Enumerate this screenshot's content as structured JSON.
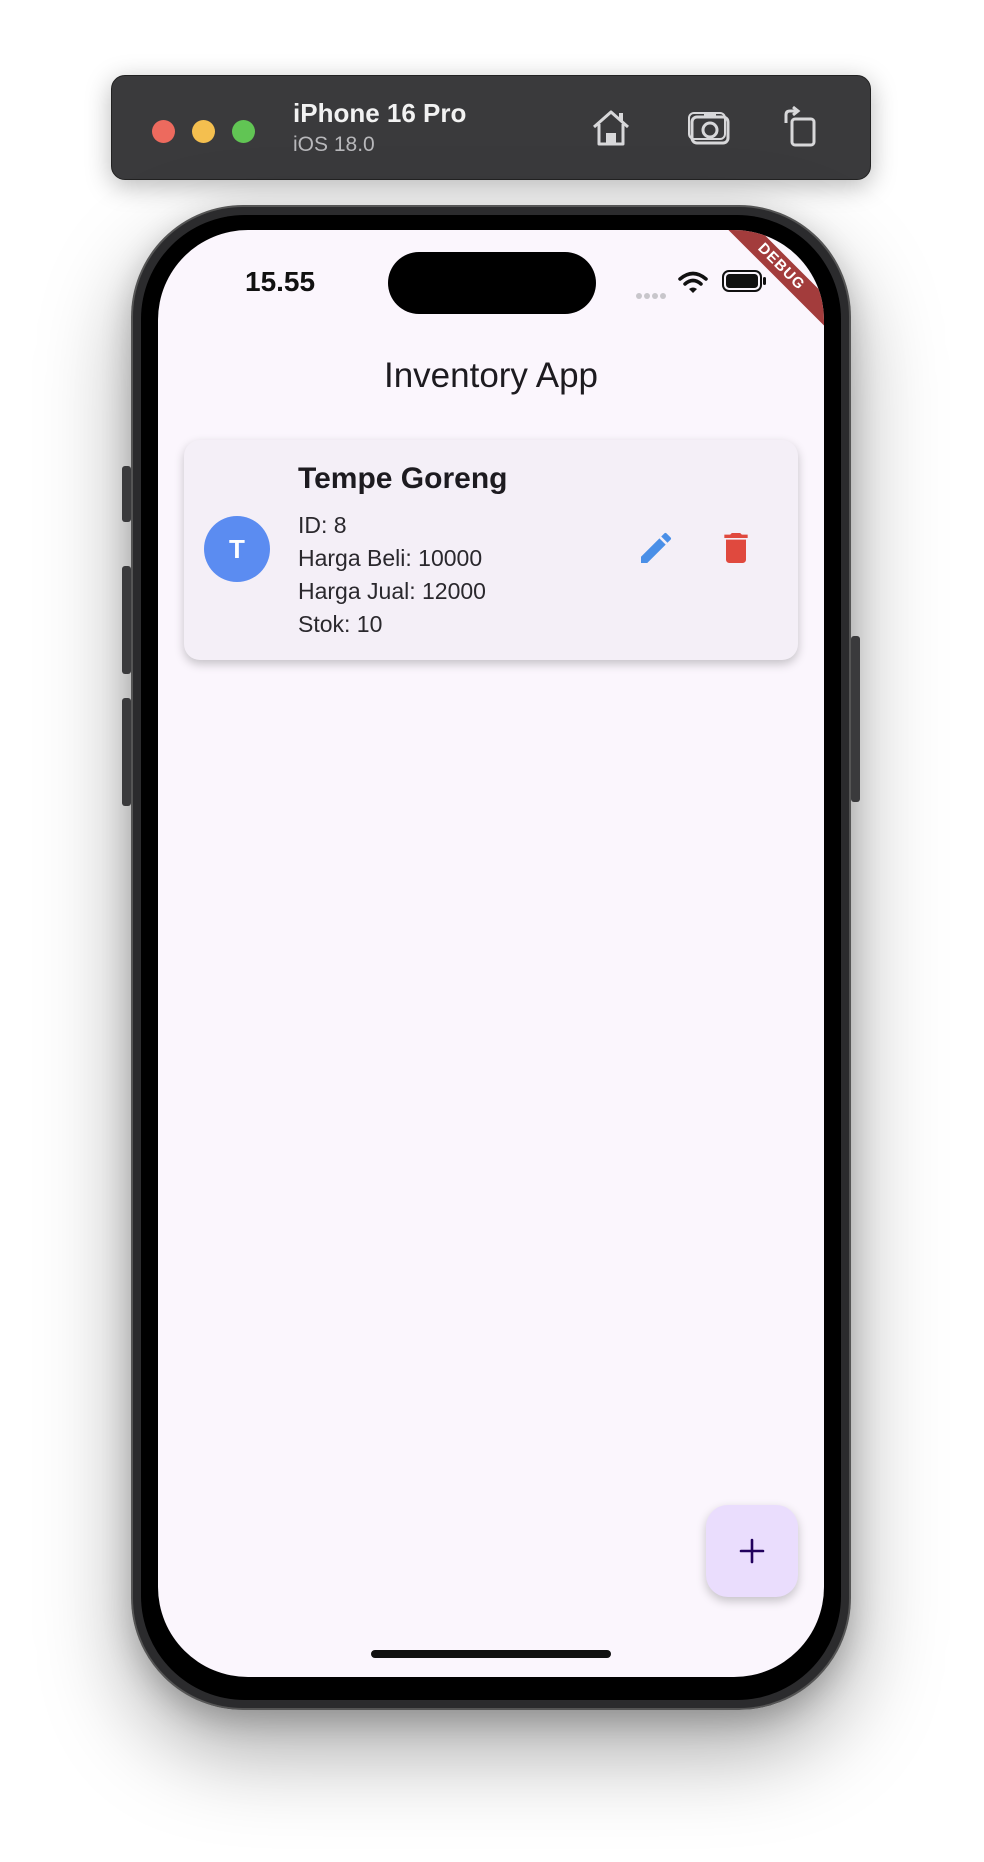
{
  "simulator": {
    "device_name": "iPhone 16 Pro",
    "os_version": "iOS 18.0",
    "toolbar_icons": [
      "home-icon",
      "screenshot-icon",
      "rotate-icon"
    ]
  },
  "status_bar": {
    "time": "15.55",
    "icons": [
      "signal-dots-icon",
      "wifi-icon",
      "battery-icon"
    ]
  },
  "debug_banner": "DEBUG",
  "app_bar": {
    "title": "Inventory App"
  },
  "products": [
    {
      "avatar_letter": "T",
      "name": "Tempe Goreng",
      "id_text": "ID: 8",
      "buy_price_text": "Harga Beli: 10000",
      "sell_price_text": "Harga Jual: 12000",
      "stock_text": "Stok: 10",
      "actions": [
        "edit-icon",
        "delete-icon"
      ]
    }
  ],
  "fab": {
    "icon": "plus-icon"
  },
  "colors": {
    "screen_bg": "#fbf6fd",
    "card_bg": "#f4eff7",
    "avatar": "#5b8cf1",
    "edit": "#4a8fe7",
    "delete": "#e0493e",
    "fab_bg": "#eaddfd",
    "debug": "#a33c3c"
  }
}
